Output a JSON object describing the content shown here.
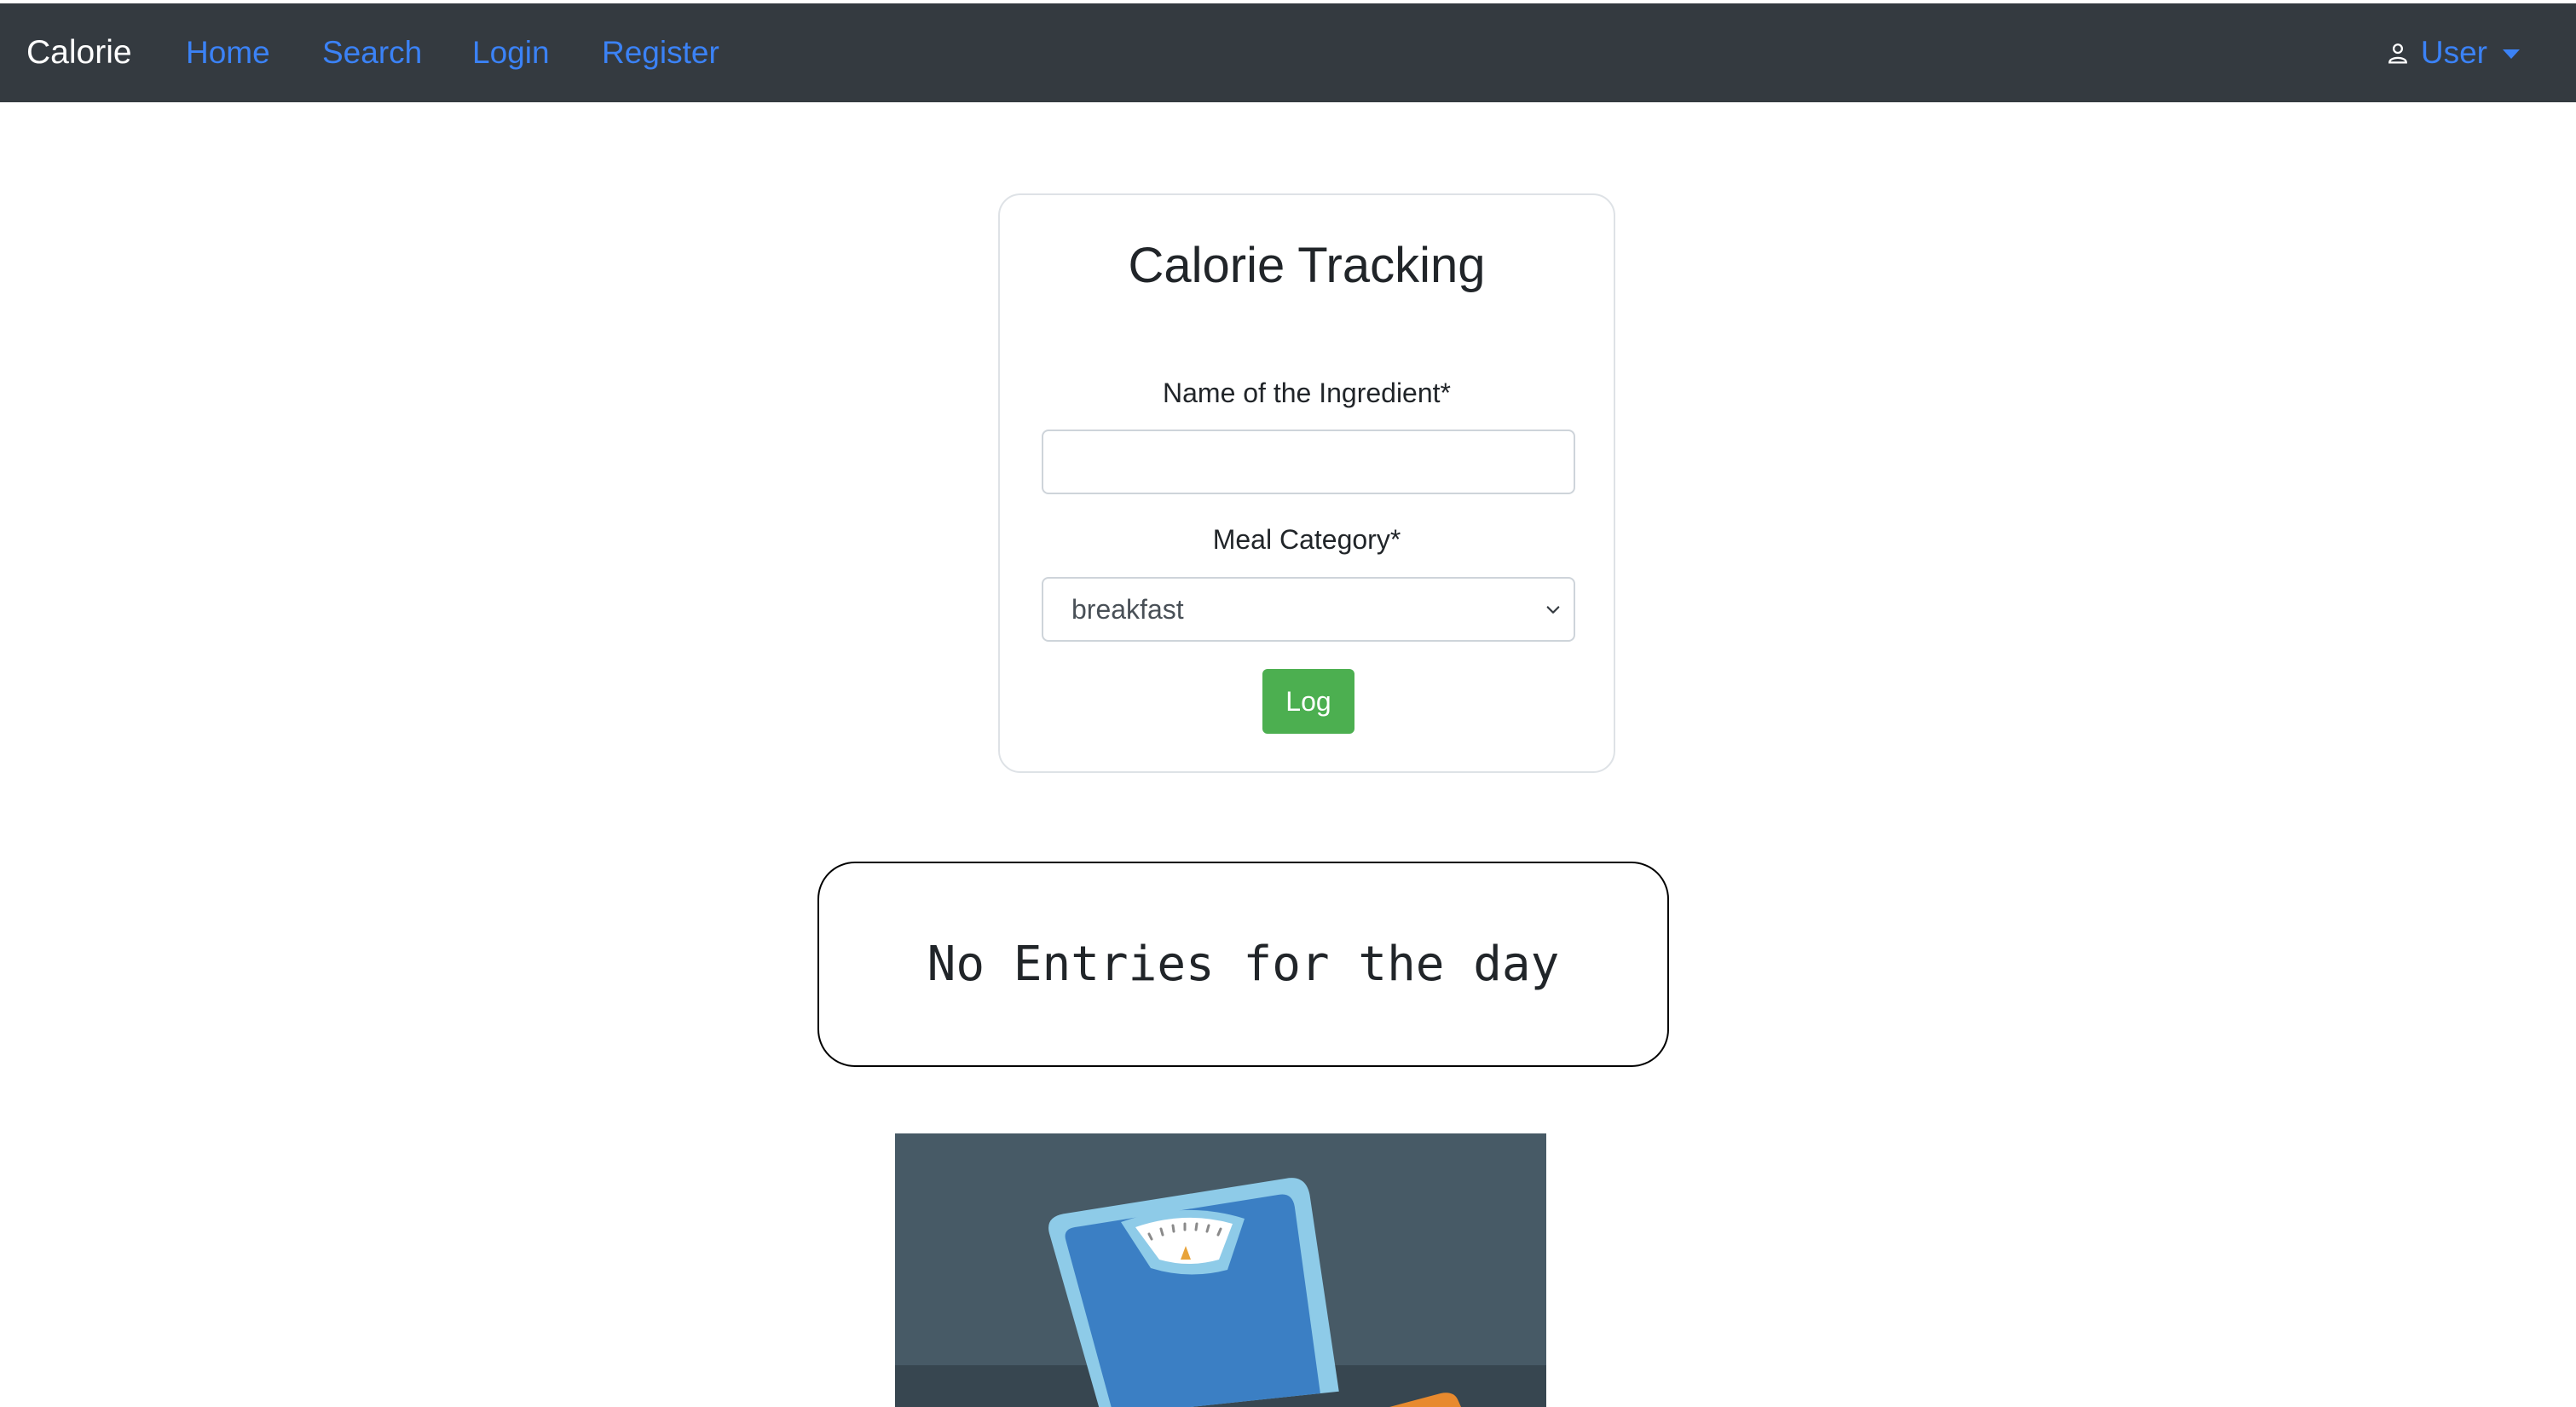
{
  "navbar": {
    "brand": "Calorie",
    "links": [
      {
        "label": "Home"
      },
      {
        "label": "Search"
      },
      {
        "label": "Login"
      },
      {
        "label": "Register"
      }
    ],
    "user_menu": {
      "label": "User",
      "icon": "user-icon"
    }
  },
  "form": {
    "title": "Calorie Tracking",
    "ingredient_label": "Name of the Ingredient*",
    "ingredient_value": "",
    "meal_label": "Meal Category*",
    "meal_selected": "breakfast",
    "submit_label": "Log"
  },
  "entries": {
    "empty_message": "No Entries for the day"
  },
  "colors": {
    "navbar_bg": "#343a40",
    "link": "#3b82f6",
    "log_button": "#4caf50",
    "illustration_bg": "#475a66"
  }
}
